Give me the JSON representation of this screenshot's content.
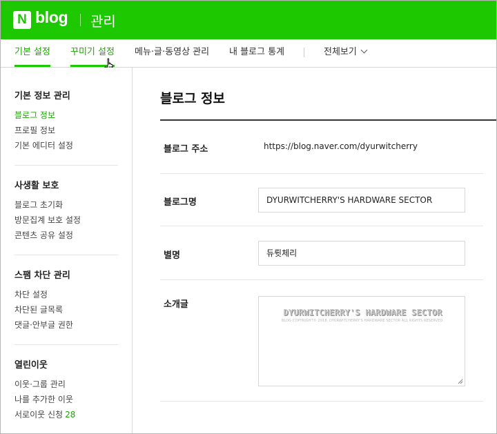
{
  "header": {
    "logo_letter": "N",
    "logo_text": "blog",
    "section_title": "관리"
  },
  "tabs": [
    {
      "label": "기본 설정",
      "state": "active"
    },
    {
      "label": "꾸미기 설정",
      "state": "hover"
    },
    {
      "label": "메뉴·글·동영상 관리",
      "state": "normal"
    },
    {
      "label": "내 블로그 통계",
      "state": "normal"
    },
    {
      "label": "전체보기",
      "state": "dropdown"
    }
  ],
  "sidebar": {
    "groups": [
      {
        "title": "기본 정보 관리",
        "items": [
          {
            "label": "블로그 정보",
            "selected": true
          },
          {
            "label": "프로필 정보"
          },
          {
            "label": "기본 에디터 설정"
          }
        ]
      },
      {
        "title": "사생활 보호",
        "items": [
          {
            "label": "블로그 초기화"
          },
          {
            "label": "방문집계 보호 설정"
          },
          {
            "label": "콘텐츠 공유 설정"
          }
        ]
      },
      {
        "title": "스팸 차단 관리",
        "items": [
          {
            "label": "차단 설정"
          },
          {
            "label": "차단된 글목록"
          },
          {
            "label": "댓글·안부글 권한"
          }
        ]
      },
      {
        "title": "열린이웃",
        "items": [
          {
            "label": "이웃·그룹 관리"
          },
          {
            "label": "나를 추가한 이웃"
          },
          {
            "label": "서로이웃 신청",
            "count": "28"
          }
        ]
      }
    ]
  },
  "main": {
    "title": "블로그 정보",
    "fields": {
      "address": {
        "label": "블로그 주소",
        "value": "https://blog.naver.com/dyurwitcherry"
      },
      "blog_name": {
        "label": "블로그명",
        "value": "DYURWITCHERRY'S HARDWARE SECTOR"
      },
      "nickname": {
        "label": "별명",
        "value": "듀륏체리"
      },
      "intro": {
        "label": "소개글",
        "banner_title": "DYURWITCHERRY'S HARDWARE SECTOR",
        "banner_sub": "BLOG COPYRIGHT© 2018. DYURWITCHERRY'S HARDWARE SECTOR ALL RIGHTS RESERVED."
      }
    }
  },
  "colors": {
    "brand_green": "#1ec800",
    "active_text_green": "#1ba700"
  },
  "icons": [
    "naver-n-logo-icon",
    "chevron-down-icon",
    "hand-pointer-cursor-icon",
    "textarea-resize-icon"
  ]
}
